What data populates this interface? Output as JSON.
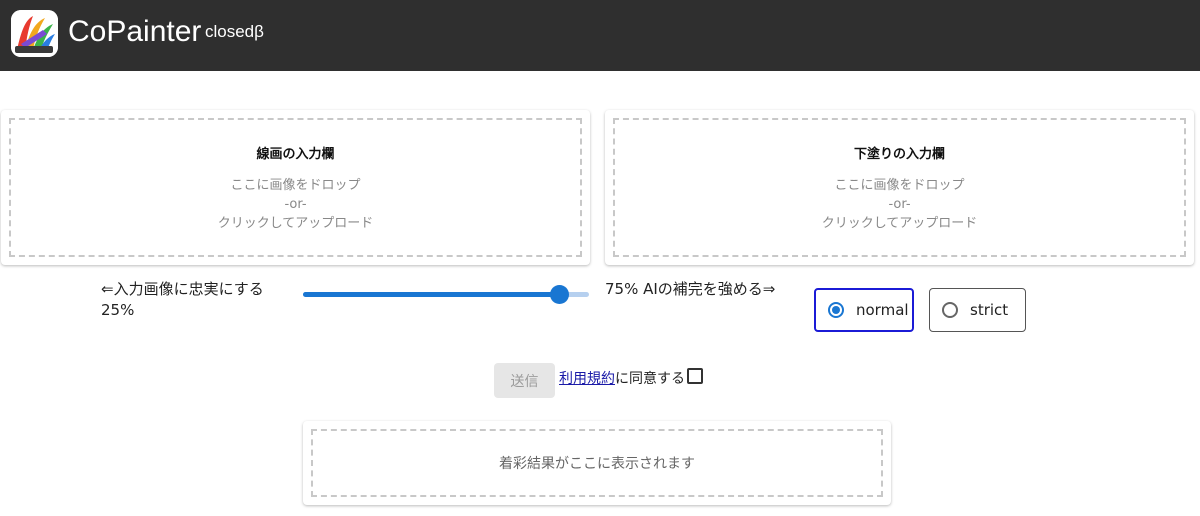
{
  "header": {
    "title": "CoPainter",
    "badge": "closedβ",
    "logo_icon": "paint-brush-logo-icon"
  },
  "upload_lineart": {
    "title": "線画の入力欄",
    "drop_text": "ここに画像をドロップ",
    "or_text": "-or-",
    "click_text": "クリックしてアップロード"
  },
  "upload_base": {
    "title": "下塗りの入力欄",
    "drop_text": "ここに画像をドロップ",
    "or_text": "-or-",
    "click_text": "クリックしてアップロード"
  },
  "slider": {
    "left_label": "⇐入力画像に忠実にする",
    "left_value": "25%",
    "right_label": "75% AIの補完を強める⇒",
    "value_percent": 90
  },
  "mode": {
    "options": [
      "normal",
      "strict"
    ],
    "selected": "normal"
  },
  "submit": {
    "label": "送信",
    "terms_link": "利用規約",
    "terms_suffix": "に同意する",
    "agreed": false
  },
  "result": {
    "placeholder": "着彩結果がここに表示されます"
  },
  "colors": {
    "header_bg": "#2f2f2f",
    "accent": "#1976d2",
    "selected_border": "#1b1bd6"
  }
}
